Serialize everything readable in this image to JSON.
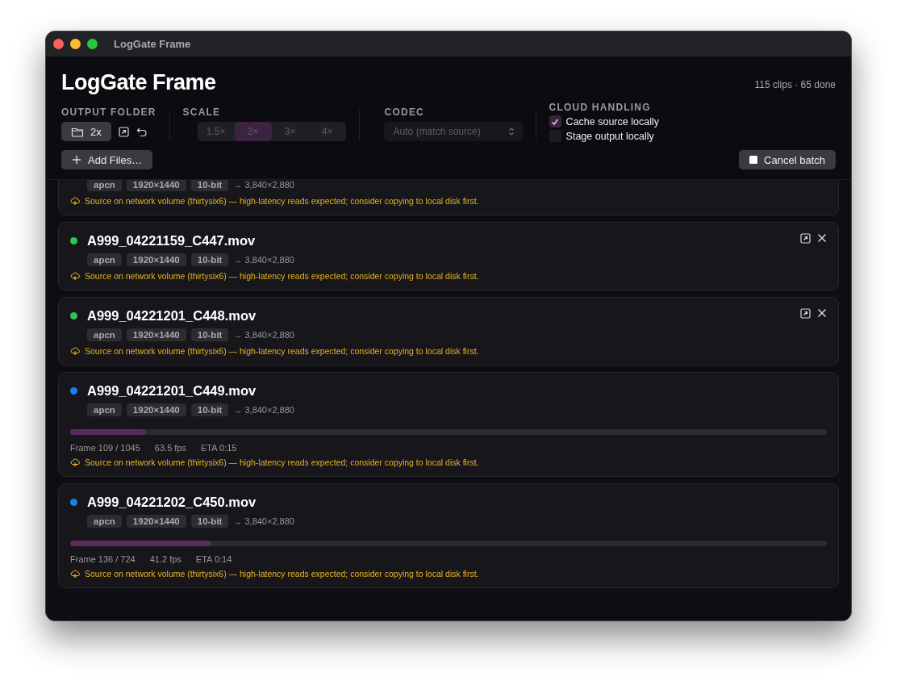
{
  "window": {
    "title": "LogGate Frame"
  },
  "header": {
    "title": "LogGate Frame",
    "summary": "115 clips · 65 done"
  },
  "output_folder": {
    "label": "OUTPUT FOLDER",
    "value": "2x"
  },
  "scale": {
    "label": "SCALE",
    "disabled": true,
    "options": [
      {
        "label": "1.5×",
        "selected": false
      },
      {
        "label": "2×",
        "selected": true
      },
      {
        "label": "3×",
        "selected": false
      },
      {
        "label": "4×",
        "selected": false
      }
    ]
  },
  "codec": {
    "label": "CODEC",
    "value": "Auto (match source)",
    "disabled": true
  },
  "cloud_handling": {
    "label": "CLOUD HANDLING",
    "options": [
      {
        "label": "Cache source locally",
        "checked": true
      },
      {
        "label": "Stage output locally",
        "checked": false
      }
    ]
  },
  "buttons": {
    "add": "Add Files…",
    "cancel": "Cancel batch"
  },
  "clips": [
    {
      "kind": "partial",
      "tags": [
        "apcn",
        "1920×1440",
        "10-bit"
      ],
      "output": "→ 3,840×2,880",
      "warning": "Source on network volume (thirtysix6) — high-latency reads expected; consider copying to local disk first."
    },
    {
      "kind": "done",
      "name": "A999_04221159_C447.mov",
      "color": "#30c453",
      "tags": [
        "apcn",
        "1920×1440",
        "10-bit"
      ],
      "output": "→ 3,840×2,880",
      "warning": "Source on network volume (thirtysix6) — high-latency reads expected; consider copying to local disk first."
    },
    {
      "kind": "done",
      "name": "A999_04221201_C448.mov",
      "color": "#30c453",
      "tags": [
        "apcn",
        "1920×1440",
        "10-bit"
      ],
      "output": "→ 3,840×2,880",
      "warning": "Source on network volume (thirtysix6) — high-latency reads expected; consider copying to local disk first."
    },
    {
      "kind": "processing",
      "name": "A999_04221201_C449.mov",
      "color": "#1a80f0",
      "tags": [
        "apcn",
        "1920×1440",
        "10-bit"
      ],
      "output": "→ 3,840×2,880",
      "level": 0.1,
      "frame": "Frame 109 / 1045",
      "fps": "63.5 fps",
      "eta": "ETA 0:15",
      "warning": "Source on network volume (thirtysix6) — high-latency reads expected; consider copying to local disk first."
    },
    {
      "kind": "processing",
      "name": "A999_04221202_C450.mov",
      "color": "#1a80f0",
      "tags": [
        "apcn",
        "1920×1440",
        "10-bit"
      ],
      "output": "→ 3,840×2,880",
      "level": 0.187,
      "frame": "Frame 136 / 724",
      "fps": "41.2 fps",
      "eta": "ETA 0:14",
      "warning": "Source on network volume (thirtysix6) — high-latency reads expected; consider copying to local disk first."
    }
  ]
}
